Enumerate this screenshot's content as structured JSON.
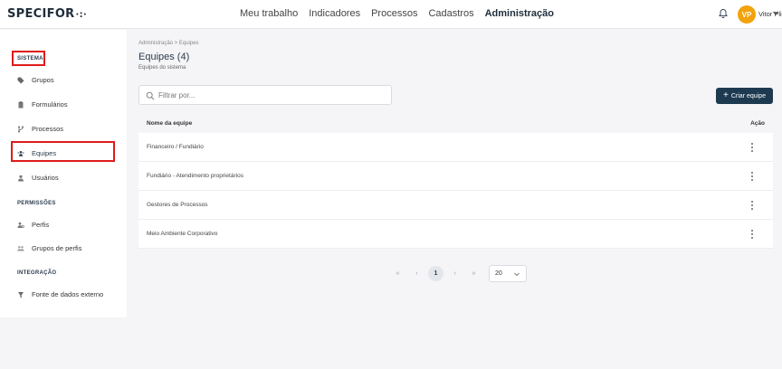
{
  "header": {
    "logo": "SPECIFOR",
    "logo_mark": "·:·",
    "nav": [
      "Meu trabalho",
      "Indicadores",
      "Processos",
      "Cadastros",
      "Administração"
    ],
    "active_nav": "Administração",
    "user_initials": "VP",
    "user_name": "Vitor Plinio"
  },
  "sidebar": {
    "sections": [
      {
        "title": "SISTEMA",
        "items": [
          "Grupos",
          "Formulários",
          "Processos",
          "Equipes",
          "Usuários"
        ]
      },
      {
        "title": "PERMISSÕES",
        "items": [
          "Perfis",
          "Grupos de perfis"
        ]
      },
      {
        "title": "INTEGRAÇÃO",
        "items": [
          "Fonte de dados externo"
        ]
      }
    ],
    "active_item": "Equipes",
    "icons": [
      "tag-icon",
      "clipboard-icon",
      "branch-icon",
      "team-icon",
      "user-icon",
      "profile-icon",
      "profile-group-icon",
      "data-source-icon"
    ]
  },
  "main": {
    "breadcrumb": "Administração > Equipes",
    "title": "Equipes (4)",
    "subtitle": "Equipes do sistema",
    "filter_placeholder": "Filtrar por...",
    "create_button": "Criar equipe",
    "table": {
      "columns": [
        "Nome da equipe",
        "Ação"
      ],
      "rows": [
        "Financeiro / Fundiário",
        "Fundiário - Atendimento proprietários",
        "Gestores de Processos",
        "Meio Ambiente Corporativo"
      ]
    },
    "pagination": {
      "first": "«",
      "prev": "‹",
      "current_page": "1",
      "next": "›",
      "last": "»",
      "page_size": "20"
    }
  },
  "colors": {
    "accent": "#1e3a50",
    "avatar": "#f2a20b",
    "highlight_box": "#e01b1b"
  }
}
